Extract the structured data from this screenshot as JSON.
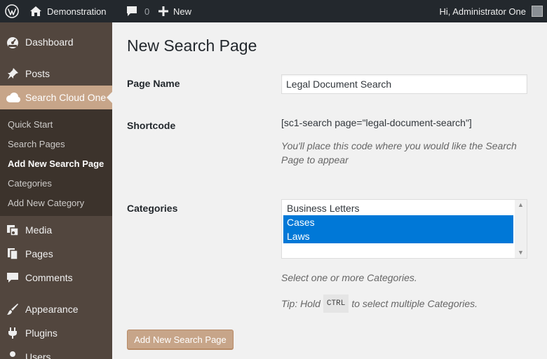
{
  "admin_bar": {
    "site_name": "Demonstration",
    "comments_count": "0",
    "new_label": "New",
    "greeting": "Hi, Administrator One"
  },
  "sidebar": {
    "items": [
      {
        "label": "Dashboard",
        "icon": "dashboard-icon"
      },
      {
        "label": "Posts",
        "icon": "pin-icon"
      },
      {
        "label": "Search Cloud One",
        "icon": "cloud-icon",
        "current": true
      },
      {
        "label": "Media",
        "icon": "media-icon"
      },
      {
        "label": "Pages",
        "icon": "pages-icon"
      },
      {
        "label": "Comments",
        "icon": "comment-icon"
      },
      {
        "label": "Appearance",
        "icon": "brush-icon"
      },
      {
        "label": "Plugins",
        "icon": "plugin-icon"
      },
      {
        "label": "Users",
        "icon": "users-icon"
      }
    ],
    "submenu": [
      {
        "label": "Quick Start"
      },
      {
        "label": "Search Pages"
      },
      {
        "label": "Add New Search Page",
        "current": true
      },
      {
        "label": "Categories"
      },
      {
        "label": "Add New Category"
      }
    ]
  },
  "main": {
    "title": "New Search Page",
    "page_name": {
      "label": "Page Name",
      "value": "Legal Document Search"
    },
    "shortcode": {
      "label": "Shortcode",
      "code": "[sc1-search page=\"legal-document-search\"]",
      "description_line1": "You'll place this code where you would like the Search",
      "description_line2": "Page to appear"
    },
    "categories": {
      "label": "Categories",
      "options": [
        {
          "label": "Business Letters",
          "selected": false
        },
        {
          "label": "Cases",
          "selected": true
        },
        {
          "label": "Laws",
          "selected": true
        }
      ],
      "help": "Select one or more Categories.",
      "tip_prefix": "Tip: Hold",
      "tip_key": "CTRL",
      "tip_suffix": "to select multiple Categories."
    },
    "submit_label": "Add New Search Page"
  },
  "colors": {
    "admin_bar": "#23282d",
    "sidebar": "#52463e",
    "submenu": "#3c332c",
    "accent": "#c7a589",
    "selection": "#0078d7"
  }
}
